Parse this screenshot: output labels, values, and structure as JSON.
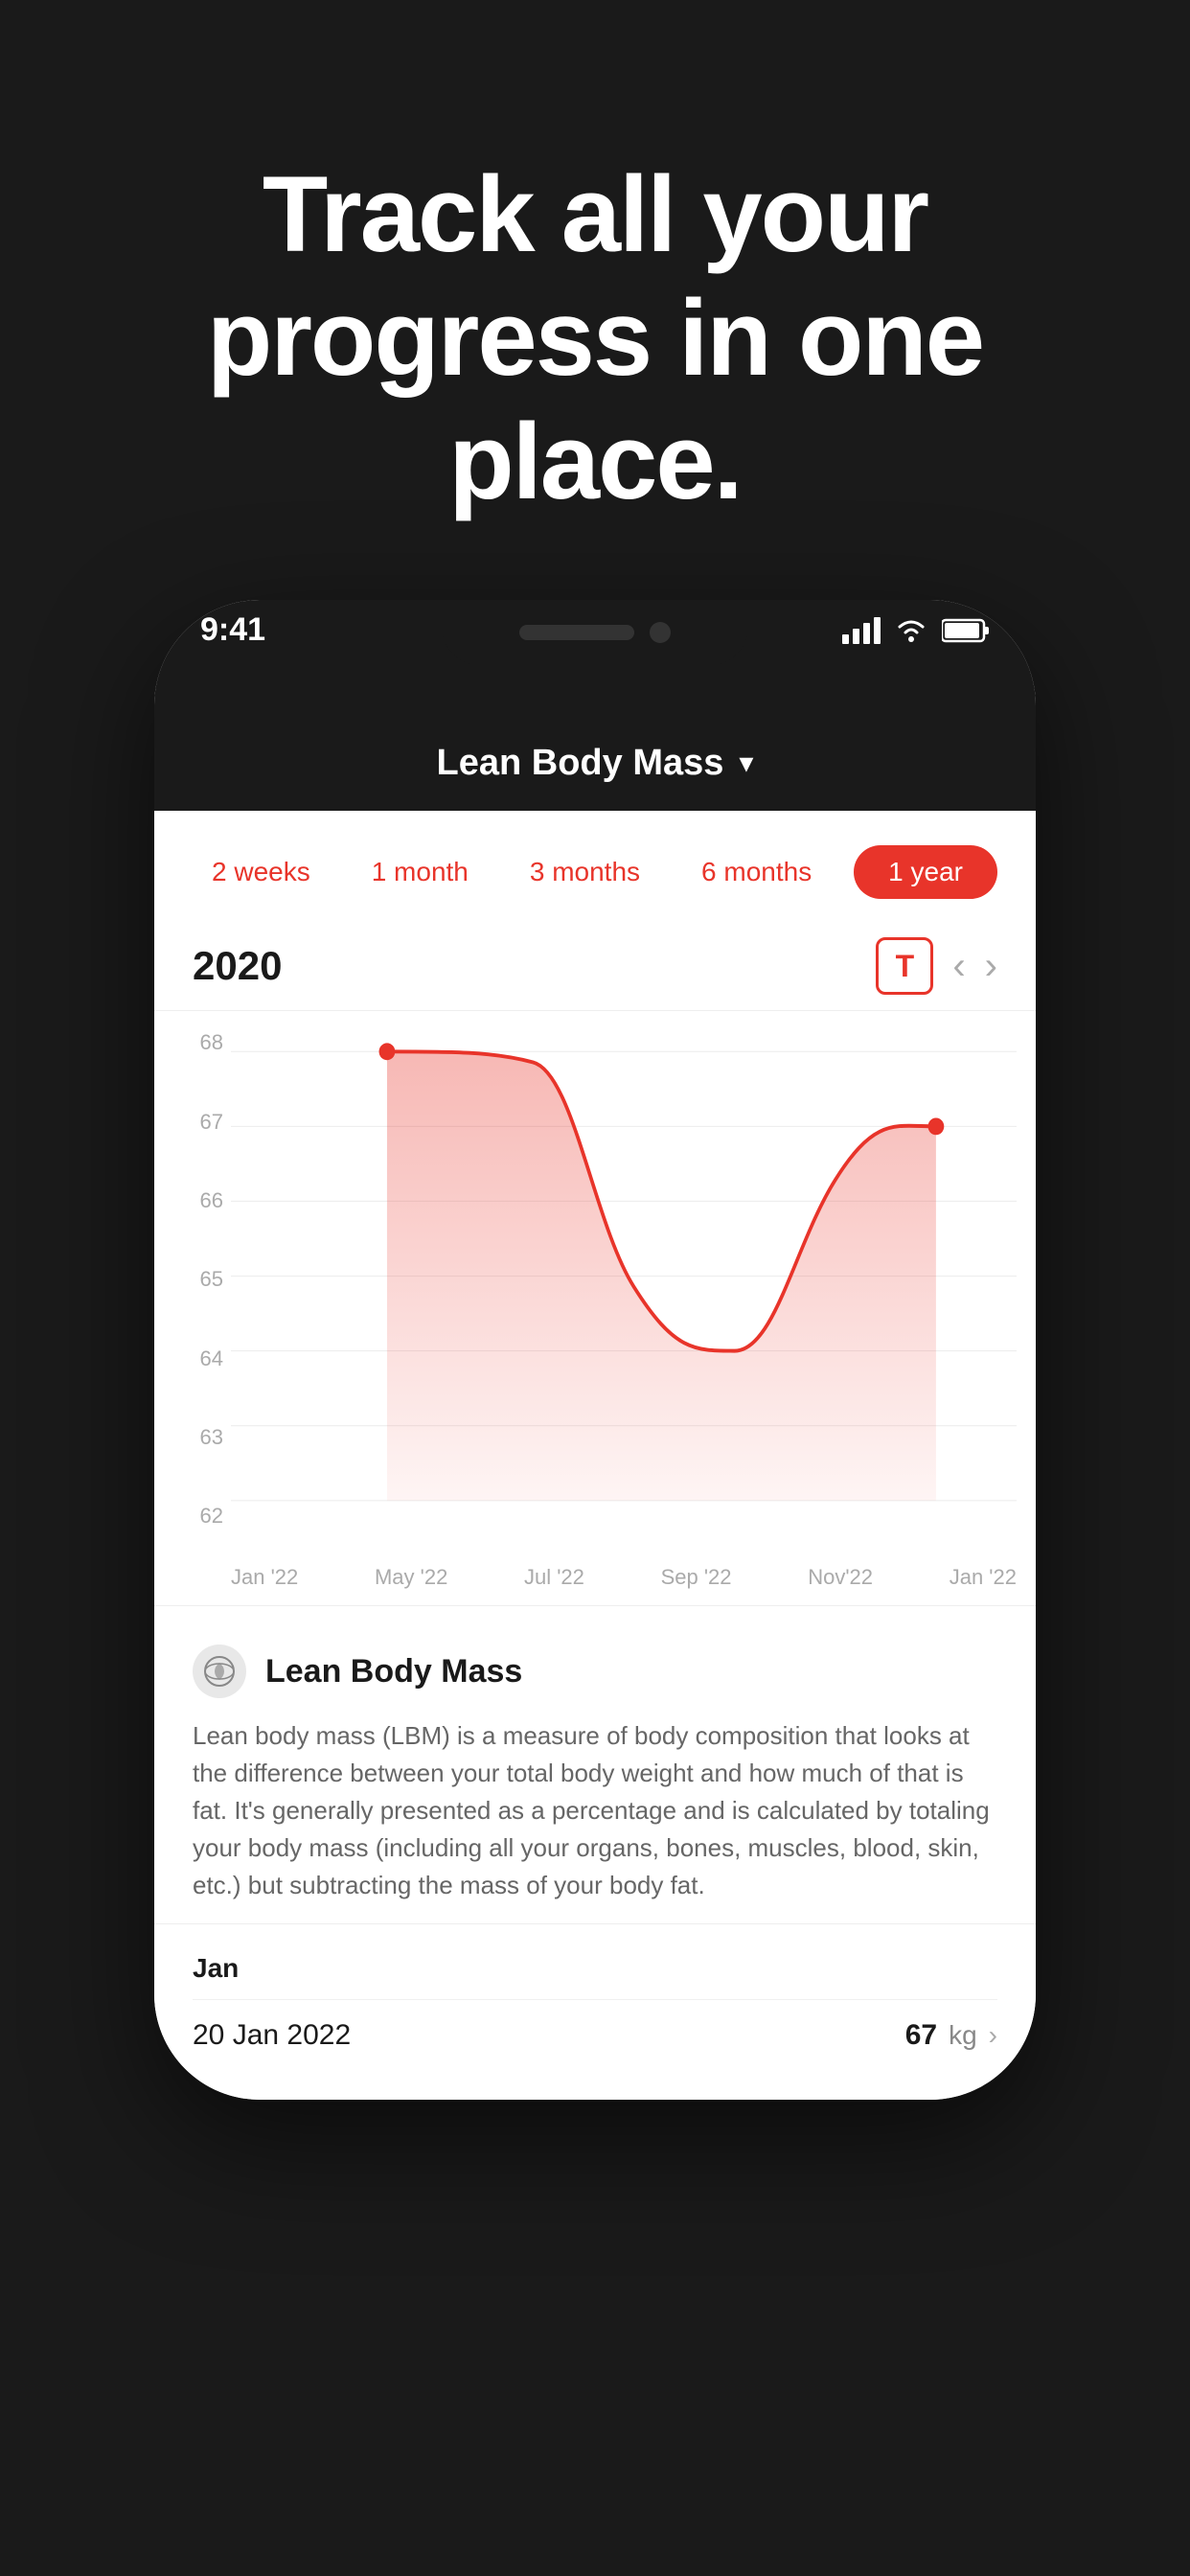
{
  "hero": {
    "title": "Track all your progress in one place."
  },
  "status_bar": {
    "time": "9:41",
    "signal": "▌▌▌",
    "wifi": "wifi",
    "battery": "battery"
  },
  "app_header": {
    "title": "Lean Body Mass",
    "chevron": "▾"
  },
  "time_tabs": {
    "tabs": [
      {
        "label": "2 weeks",
        "active": false
      },
      {
        "label": "1 month",
        "active": false
      },
      {
        "label": "3 months",
        "active": false
      },
      {
        "label": "6 months",
        "active": false
      },
      {
        "label": "1 year",
        "active": true
      }
    ]
  },
  "chart": {
    "year": "2020",
    "table_icon": "T",
    "y_labels": [
      "68",
      "67",
      "66",
      "65",
      "64",
      "63",
      "62"
    ],
    "x_labels": [
      "Jan '22",
      "May '22",
      "Jul '22",
      "Sep '22",
      "Nov'22",
      "Jan '22"
    ]
  },
  "info": {
    "icon": "🌍",
    "title": "Lean Body Mass",
    "description": "Lean body mass (LBM) is a measure of body composition that looks at the difference between your total body weight and how much of that is fat. It's generally presented as a percentage and is calculated by totaling your body mass (including all your organs, bones, muscles, blood, skin, etc.) but subtracting the mass of your body fat."
  },
  "data_entries": {
    "month": "Jan",
    "entries": [
      {
        "date": "20 Jan 2022",
        "value": "67",
        "unit": "kg"
      }
    ]
  },
  "colors": {
    "accent": "#e8342a",
    "background_dark": "#1a1a1a",
    "text_primary": "#1a1a1a",
    "text_secondary": "#666666",
    "chart_fill": "rgba(232, 52, 42, 0.2)",
    "chart_line": "#e8342a"
  }
}
